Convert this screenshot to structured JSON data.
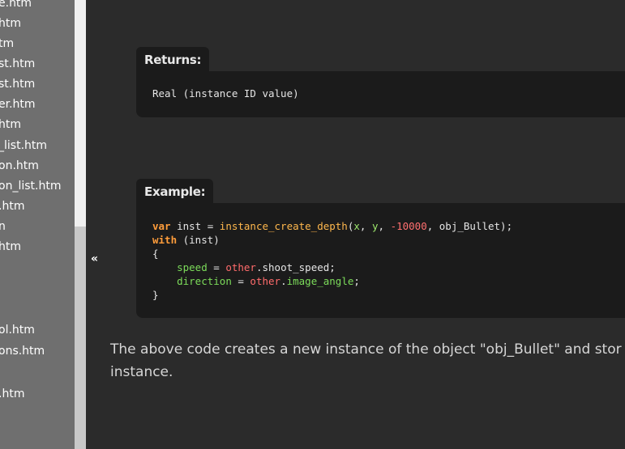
{
  "sidebar": {
    "items": [
      {
        "label": "e.htm"
      },
      {
        "label": "htm"
      },
      {
        "label": "tm"
      },
      {
        "label": "st.htm"
      },
      {
        "label": "st.htm"
      },
      {
        "label": "er.htm"
      },
      {
        "label": "htm"
      },
      {
        "label": "_list.htm"
      },
      {
        "label": "on.htm"
      },
      {
        "label": "on_list.htm"
      },
      {
        "label": ".htm"
      },
      {
        "label": "n"
      },
      {
        "label": "htm"
      },
      {
        "label": "ol.htm"
      },
      {
        "label": "ons.htm"
      },
      {
        "label": ".htm"
      }
    ]
  },
  "main": {
    "collapse_label": "«",
    "returns": {
      "heading": "Returns:",
      "value": "Real (instance ID value)"
    },
    "example": {
      "heading": "Example:",
      "tokens": {
        "var": "var",
        "inst": "inst",
        "eq": " = ",
        "fn": "instance_create_depth",
        "open": "(",
        "x": "x",
        "comma1": ", ",
        "y": "y",
        "comma2": ", ",
        "num": "-10000",
        "comma3": ", ",
        "obj": "obj_Bullet",
        "close": ");",
        "with": "with",
        "with_arg": " (inst)",
        "brace_open": "{",
        "speed": "speed",
        "eq2": " = ",
        "other1": "other",
        "shoot": ".shoot_speed;",
        "direction": "direction",
        "eq3": " = ",
        "other2": "other",
        "dot": ".",
        "angle": "image_angle",
        "semi": ";",
        "brace_close": "}"
      }
    },
    "description": {
      "line1": "The above code creates a new instance of the object \"obj_Bullet\" and stor",
      "line2": "instance."
    }
  }
}
